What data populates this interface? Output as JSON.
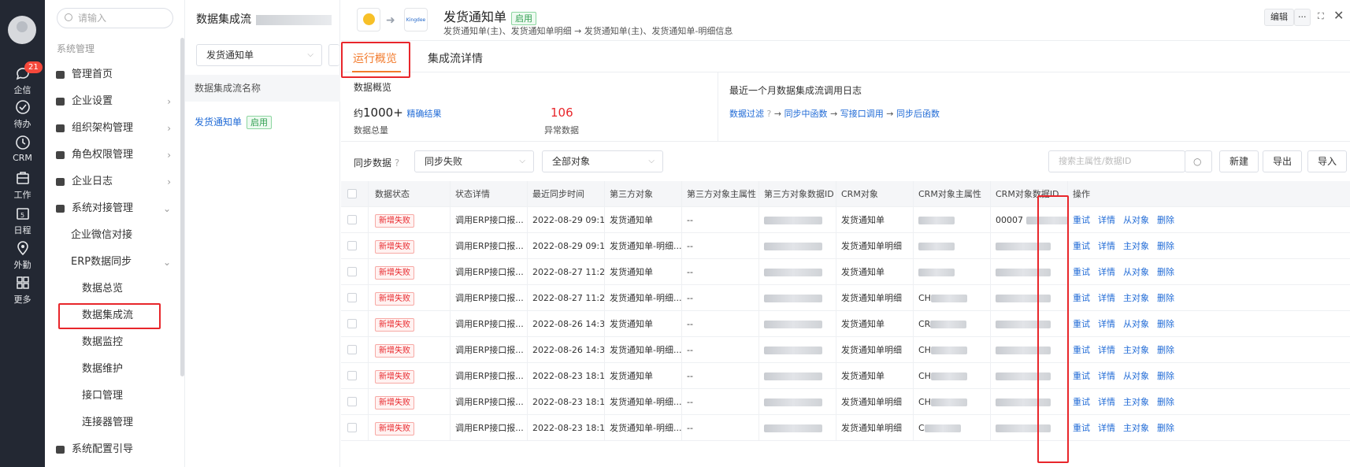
{
  "rail": {
    "badge": "21",
    "items": [
      "企信",
      "待办",
      "CRM",
      "工作",
      "日程",
      "外勤",
      "更多"
    ]
  },
  "sidebar": {
    "search_placeholder": "请输入",
    "section": "系统管理",
    "items": [
      {
        "label": "管理首页"
      },
      {
        "label": "企业设置"
      },
      {
        "label": "组织架构管理"
      },
      {
        "label": "角色权限管理"
      },
      {
        "label": "企业日志"
      },
      {
        "label": "系统对接管理"
      },
      {
        "label": "企业微信对接"
      },
      {
        "label": "ERP数据同步"
      },
      {
        "label": "数据总览"
      },
      {
        "label": "数据集成流"
      },
      {
        "label": "数据监控"
      },
      {
        "label": "数据维护"
      },
      {
        "label": "接口管理"
      },
      {
        "label": "连接器管理"
      },
      {
        "label": "系统配置引导"
      }
    ]
  },
  "list": {
    "title": "数据集成流",
    "filter": "发货通知单",
    "header": "数据集成流名称",
    "row_label": "发货通知单",
    "row_status": "启用"
  },
  "main": {
    "title": "发货通知单",
    "status": "启用",
    "subtitle": "发货通知单(主)、发货通知单明细 → 发货通知单(主)、发货通知单-明细信息",
    "logo2_text": "Kingdee",
    "edit_label": "编辑",
    "more_label": "···",
    "tabs": [
      "运行概览",
      "集成流详情"
    ],
    "overview": {
      "title": "数据概览",
      "total_prefix": "约",
      "total_value": "1000+",
      "total_link": "精确结果",
      "total_label": "数据总量",
      "error_value": "106",
      "error_label": "异常数据",
      "log_title": "最近一个月数据集成流调用日志",
      "log_steps": [
        "数据过滤",
        "同步中函数",
        "写接口调用",
        "同步后函数"
      ]
    },
    "toolbar": {
      "label": "同步数据",
      "status_select": "同步失败",
      "object_select": "全部对象",
      "search_placeholder": "搜索主属性/数据ID",
      "new": "新建",
      "export": "导出",
      "import": "导入"
    },
    "columns": [
      "数据状态",
      "状态详情",
      "最近同步时间",
      "第三方对象",
      "第三方对象主属性",
      "第三方对象数据ID",
      "CRM对象",
      "CRM对象主属性",
      "CRM对象数据ID",
      "操作"
    ],
    "rows": [
      {
        "status": "新增失败",
        "detail": "调用ERP接口报...",
        "time": "2022-08-29 09:1...",
        "third": "发货通知单",
        "third_main": "--",
        "crm": "发货通知单",
        "crm_main": "",
        "crm_id_prefix": "00007 ",
        "a1": "重试",
        "a2": "详情",
        "a3": "从对象",
        "a4": "删除"
      },
      {
        "status": "新增失败",
        "detail": "调用ERP接口报...",
        "time": "2022-08-29 09:1...",
        "third": "发货通知单-明细...",
        "third_main": "--",
        "crm": "发货通知单明细",
        "crm_main": "",
        "crm_id_prefix": "",
        "a1": "重试",
        "a2": "详情",
        "a3": "主对象",
        "a4": "删除"
      },
      {
        "status": "新增失败",
        "detail": "调用ERP接口报...",
        "time": "2022-08-27 11:2...",
        "third": "发货通知单",
        "third_main": "--",
        "crm": "发货通知单",
        "crm_main": "",
        "crm_id_prefix": "",
        "a1": "重试",
        "a2": "详情",
        "a3": "从对象",
        "a4": "删除"
      },
      {
        "status": "新增失败",
        "detail": "调用ERP接口报...",
        "time": "2022-08-27 11:2...",
        "third": "发货通知单-明细...",
        "third_main": "--",
        "crm": "发货通知单明细",
        "crm_main": "CH",
        "crm_id_prefix": "",
        "a1": "重试",
        "a2": "详情",
        "a3": "主对象",
        "a4": "删除"
      },
      {
        "status": "新增失败",
        "detail": "调用ERP接口报...",
        "time": "2022-08-26 14:3...",
        "third": "发货通知单",
        "third_main": "--",
        "crm": "发货通知单",
        "crm_main": "CR",
        "crm_id_prefix": "",
        "a1": "重试",
        "a2": "详情",
        "a3": "从对象",
        "a4": "删除"
      },
      {
        "status": "新增失败",
        "detail": "调用ERP接口报...",
        "time": "2022-08-26 14:3...",
        "third": "发货通知单-明细...",
        "third_main": "--",
        "crm": "发货通知单明细",
        "crm_main": "CH",
        "crm_id_prefix": "",
        "a1": "重试",
        "a2": "详情",
        "a3": "主对象",
        "a4": "删除"
      },
      {
        "status": "新增失败",
        "detail": "调用ERP接口报...",
        "time": "2022-08-23 18:1...",
        "third": "发货通知单",
        "third_main": "--",
        "crm": "发货通知单",
        "crm_main": "CH",
        "crm_id_prefix": "",
        "a1": "重试",
        "a2": "详情",
        "a3": "从对象",
        "a4": "删除"
      },
      {
        "status": "新增失败",
        "detail": "调用ERP接口报...",
        "time": "2022-08-23 18:1...",
        "third": "发货通知单-明细...",
        "third_main": "--",
        "crm": "发货通知单明细",
        "crm_main": "CH",
        "crm_id_prefix": "",
        "a1": "重试",
        "a2": "详情",
        "a3": "主对象",
        "a4": "删除"
      },
      {
        "status": "新增失败",
        "detail": "调用ERP接口报...",
        "time": "2022-08-23 18:1...",
        "third": "发货通知单-明细...",
        "third_main": "--",
        "crm": "发货通知单明细",
        "crm_main": "C",
        "crm_id_prefix": "",
        "a1": "重试",
        "a2": "详情",
        "a3": "主对象",
        "a4": "删除"
      }
    ],
    "colors": {
      "accent": "#f27b2d",
      "link": "#1f6ad6",
      "danger": "#e8262b",
      "success": "#2f9e4f",
      "highlight": "#e8262b"
    }
  }
}
